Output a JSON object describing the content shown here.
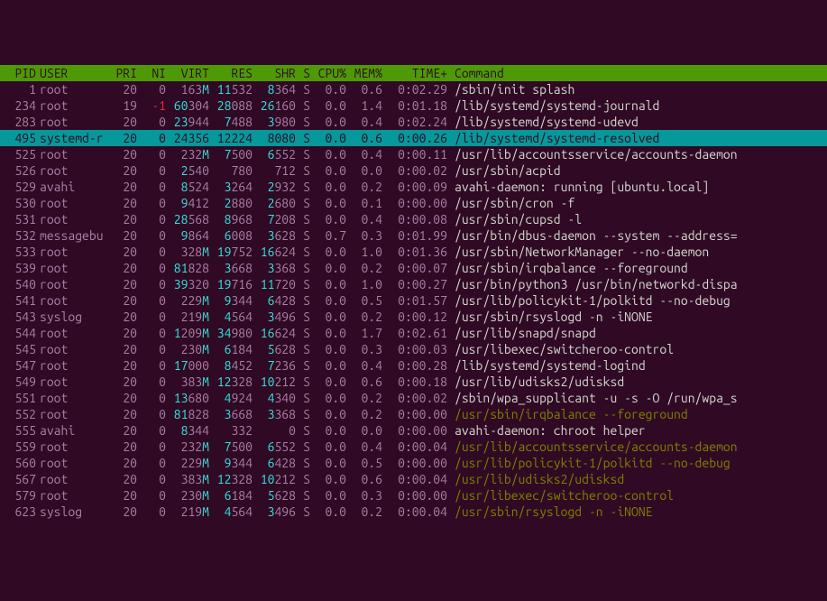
{
  "columns": {
    "pid": "PID",
    "user": "USER",
    "pri": "PRI",
    "ni": "NI",
    "virt": "VIRT",
    "res": "RES",
    "shr": "SHR",
    "s": "S",
    "cpu": "CPU%",
    "mem": "MEM%",
    "time": "TIME+",
    "cmd": "Command"
  },
  "selected_pid": 495,
  "rows": [
    {
      "pid": 1,
      "user": "root",
      "pri": 20,
      "ni": 0,
      "virt": "163M",
      "res": "11532",
      "shr": "8364",
      "s": "S",
      "cpu": "0.0",
      "mem": "0.6",
      "time": "0:02.29",
      "cmd": "/sbin/init splash",
      "thread": false
    },
    {
      "pid": 234,
      "user": "root",
      "pri": 19,
      "ni": -1,
      "virt": "60304",
      "res": "28088",
      "shr": "26160",
      "s": "S",
      "cpu": "0.0",
      "mem": "1.4",
      "time": "0:01.18",
      "cmd": "/lib/systemd/systemd-journald",
      "thread": false
    },
    {
      "pid": 283,
      "user": "root",
      "pri": 20,
      "ni": 0,
      "virt": "23944",
      "res": "7488",
      "shr": "3980",
      "s": "S",
      "cpu": "0.0",
      "mem": "0.4",
      "time": "0:02.24",
      "cmd": "/lib/systemd/systemd-udevd",
      "thread": false
    },
    {
      "pid": 495,
      "user": "systemd-r",
      "pri": 20,
      "ni": 0,
      "virt": "24356",
      "res": "12224",
      "shr": "8080",
      "s": "S",
      "cpu": "0.0",
      "mem": "0.6",
      "time": "0:00.26",
      "cmd": "/lib/systemd/systemd-resolved",
      "thread": false
    },
    {
      "pid": 525,
      "user": "root",
      "pri": 20,
      "ni": 0,
      "virt": "232M",
      "res": "7500",
      "shr": "6552",
      "s": "S",
      "cpu": "0.0",
      "mem": "0.4",
      "time": "0:00.11",
      "cmd": "/usr/lib/accountsservice/accounts-daemon",
      "thread": false
    },
    {
      "pid": 526,
      "user": "root",
      "pri": 20,
      "ni": 0,
      "virt": "2540",
      "res": "780",
      "shr": "712",
      "s": "S",
      "cpu": "0.0",
      "mem": "0.0",
      "time": "0:00.02",
      "cmd": "/usr/sbin/acpid",
      "thread": false
    },
    {
      "pid": 529,
      "user": "avahi",
      "pri": 20,
      "ni": 0,
      "virt": "8524",
      "res": "3264",
      "shr": "2932",
      "s": "S",
      "cpu": "0.0",
      "mem": "0.2",
      "time": "0:00.09",
      "cmd": "avahi-daemon: running [ubuntu.local]",
      "thread": false
    },
    {
      "pid": 530,
      "user": "root",
      "pri": 20,
      "ni": 0,
      "virt": "9412",
      "res": "2880",
      "shr": "2680",
      "s": "S",
      "cpu": "0.0",
      "mem": "0.1",
      "time": "0:00.00",
      "cmd": "/usr/sbin/cron -f",
      "thread": false
    },
    {
      "pid": 531,
      "user": "root",
      "pri": 20,
      "ni": 0,
      "virt": "28568",
      "res": "8968",
      "shr": "7208",
      "s": "S",
      "cpu": "0.0",
      "mem": "0.4",
      "time": "0:00.08",
      "cmd": "/usr/sbin/cupsd -l",
      "thread": false
    },
    {
      "pid": 532,
      "user": "messagebu",
      "pri": 20,
      "ni": 0,
      "virt": "9864",
      "res": "6008",
      "shr": "3628",
      "s": "S",
      "cpu": "0.7",
      "mem": "0.3",
      "time": "0:01.99",
      "cmd": "/usr/bin/dbus-daemon --system --address=",
      "thread": false
    },
    {
      "pid": 533,
      "user": "root",
      "pri": 20,
      "ni": 0,
      "virt": "328M",
      "res": "19752",
      "shr": "16624",
      "s": "S",
      "cpu": "0.0",
      "mem": "1.0",
      "time": "0:01.36",
      "cmd": "/usr/sbin/NetworkManager --no-daemon",
      "thread": false
    },
    {
      "pid": 539,
      "user": "root",
      "pri": 20,
      "ni": 0,
      "virt": "81828",
      "res": "3668",
      "shr": "3368",
      "s": "S",
      "cpu": "0.0",
      "mem": "0.2",
      "time": "0:00.07",
      "cmd": "/usr/sbin/irqbalance --foreground",
      "thread": false
    },
    {
      "pid": 540,
      "user": "root",
      "pri": 20,
      "ni": 0,
      "virt": "39320",
      "res": "19716",
      "shr": "11720",
      "s": "S",
      "cpu": "0.0",
      "mem": "1.0",
      "time": "0:00.27",
      "cmd": "/usr/bin/python3 /usr/bin/networkd-dispa",
      "thread": false
    },
    {
      "pid": 541,
      "user": "root",
      "pri": 20,
      "ni": 0,
      "virt": "229M",
      "res": "9344",
      "shr": "6428",
      "s": "S",
      "cpu": "0.0",
      "mem": "0.5",
      "time": "0:01.57",
      "cmd": "/usr/lib/policykit-1/polkitd --no-debug",
      "thread": false
    },
    {
      "pid": 543,
      "user": "syslog",
      "pri": 20,
      "ni": 0,
      "virt": "219M",
      "res": "4564",
      "shr": "3496",
      "s": "S",
      "cpu": "0.0",
      "mem": "0.2",
      "time": "0:00.12",
      "cmd": "/usr/sbin/rsyslogd -n -iNONE",
      "thread": false
    },
    {
      "pid": 544,
      "user": "root",
      "pri": 20,
      "ni": 0,
      "virt": "1209M",
      "res": "34980",
      "shr": "16624",
      "s": "S",
      "cpu": "0.0",
      "mem": "1.7",
      "time": "0:02.61",
      "cmd": "/usr/lib/snapd/snapd",
      "thread": false
    },
    {
      "pid": 545,
      "user": "root",
      "pri": 20,
      "ni": 0,
      "virt": "230M",
      "res": "6184",
      "shr": "5628",
      "s": "S",
      "cpu": "0.0",
      "mem": "0.3",
      "time": "0:00.03",
      "cmd": "/usr/libexec/switcheroo-control",
      "thread": false
    },
    {
      "pid": 547,
      "user": "root",
      "pri": 20,
      "ni": 0,
      "virt": "17000",
      "res": "8452",
      "shr": "7236",
      "s": "S",
      "cpu": "0.0",
      "mem": "0.4",
      "time": "0:00.28",
      "cmd": "/lib/systemd/systemd-logind",
      "thread": false
    },
    {
      "pid": 549,
      "user": "root",
      "pri": 20,
      "ni": 0,
      "virt": "383M",
      "res": "12328",
      "shr": "10212",
      "s": "S",
      "cpu": "0.0",
      "mem": "0.6",
      "time": "0:00.18",
      "cmd": "/usr/lib/udisks2/udisksd",
      "thread": false
    },
    {
      "pid": 551,
      "user": "root",
      "pri": 20,
      "ni": 0,
      "virt": "13680",
      "res": "4924",
      "shr": "4340",
      "s": "S",
      "cpu": "0.0",
      "mem": "0.2",
      "time": "0:00.02",
      "cmd": "/sbin/wpa_supplicant -u -s -O /run/wpa_s",
      "thread": false
    },
    {
      "pid": 552,
      "user": "root",
      "pri": 20,
      "ni": 0,
      "virt": "81828",
      "res": "3668",
      "shr": "3368",
      "s": "S",
      "cpu": "0.0",
      "mem": "0.2",
      "time": "0:00.00",
      "cmd": "/usr/sbin/irqbalance --foreground",
      "thread": true
    },
    {
      "pid": 555,
      "user": "avahi",
      "pri": 20,
      "ni": 0,
      "virt": "8344",
      "res": "332",
      "shr": "0",
      "s": "S",
      "cpu": "0.0",
      "mem": "0.0",
      "time": "0:00.00",
      "cmd": "avahi-daemon: chroot helper",
      "thread": false
    },
    {
      "pid": 559,
      "user": "root",
      "pri": 20,
      "ni": 0,
      "virt": "232M",
      "res": "7500",
      "shr": "6552",
      "s": "S",
      "cpu": "0.0",
      "mem": "0.4",
      "time": "0:00.04",
      "cmd": "/usr/lib/accountsservice/accounts-daemon",
      "thread": true
    },
    {
      "pid": 560,
      "user": "root",
      "pri": 20,
      "ni": 0,
      "virt": "229M",
      "res": "9344",
      "shr": "6428",
      "s": "S",
      "cpu": "0.0",
      "mem": "0.5",
      "time": "0:00.00",
      "cmd": "/usr/lib/policykit-1/polkitd --no-debug",
      "thread": true
    },
    {
      "pid": 567,
      "user": "root",
      "pri": 20,
      "ni": 0,
      "virt": "383M",
      "res": "12328",
      "shr": "10212",
      "s": "S",
      "cpu": "0.0",
      "mem": "0.6",
      "time": "0:00.04",
      "cmd": "/usr/lib/udisks2/udisksd",
      "thread": true
    },
    {
      "pid": 579,
      "user": "root",
      "pri": 20,
      "ni": 0,
      "virt": "230M",
      "res": "6184",
      "shr": "5628",
      "s": "S",
      "cpu": "0.0",
      "mem": "0.3",
      "time": "0:00.00",
      "cmd": "/usr/libexec/switcheroo-control",
      "thread": true
    },
    {
      "pid": 623,
      "user": "syslog",
      "pri": 20,
      "ni": 0,
      "virt": "219M",
      "res": "4564",
      "shr": "3496",
      "s": "S",
      "cpu": "0.0",
      "mem": "0.2",
      "time": "0:00.04",
      "cmd": "/usr/sbin/rsyslogd -n -iNONE",
      "thread": true
    }
  ]
}
